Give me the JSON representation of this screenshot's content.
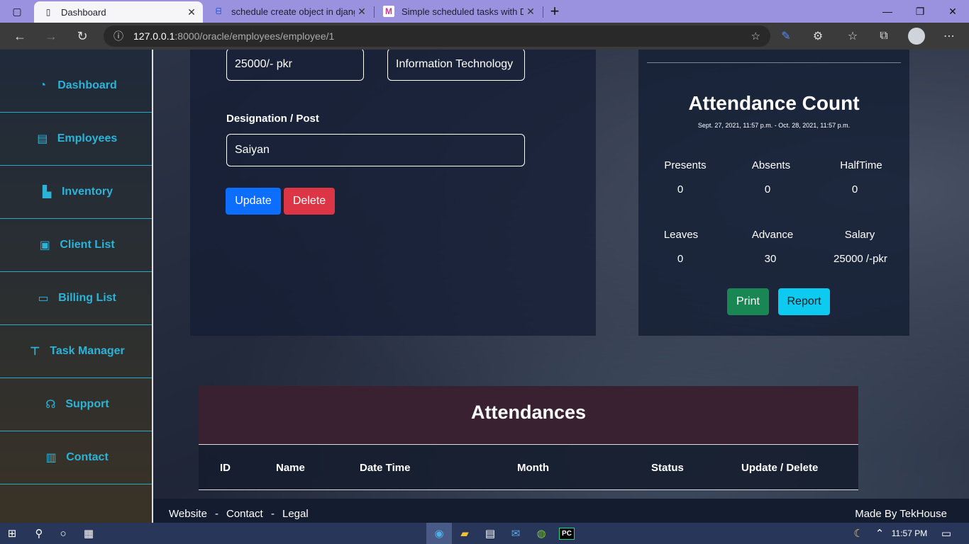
{
  "browser": {
    "tabs": [
      {
        "title": "Dashboard"
      },
      {
        "title": "schedule create object in django"
      },
      {
        "title": "Simple scheduled tasks with Djan"
      }
    ],
    "new_tab_glyph": "+",
    "url_host": "127.0.0.1",
    "url_path": ":8000/oracle/employees/employee/1"
  },
  "sidebar": {
    "items": [
      {
        "label": "Dashboard",
        "icon": "tachometer-icon"
      },
      {
        "label": "Employees",
        "icon": "id-card-icon"
      },
      {
        "label": "Inventory",
        "icon": "dolly-icon"
      },
      {
        "label": "Client List",
        "icon": "contact-book-icon"
      },
      {
        "label": "Billing List",
        "icon": "money-bill-icon"
      },
      {
        "label": "Task Manager",
        "icon": "thumbtack-icon"
      },
      {
        "label": "Support",
        "icon": "headset-icon"
      },
      {
        "label": "Contact",
        "icon": "id-badge-icon"
      }
    ]
  },
  "form": {
    "salary_value": "25000/- pkr",
    "department_value": "Information Technology",
    "designation_label": "Designation / Post",
    "designation_value": "Saiyan",
    "update_label": "Update",
    "delete_label": "Delete"
  },
  "attendance_count": {
    "title": "Attendance Count",
    "range": "Sept. 27, 2021, 11:57 p.m. - Oct. 28, 2021, 11:57 p.m.",
    "stats": [
      {
        "label": "Presents",
        "value": "0"
      },
      {
        "label": "Absents",
        "value": "0"
      },
      {
        "label": "HalfTime",
        "value": "0"
      },
      {
        "label": "Leaves",
        "value": "0"
      },
      {
        "label": "Advance",
        "value": "30"
      },
      {
        "label": "Salary",
        "value": "25000 /-pkr"
      }
    ],
    "print_label": "Print",
    "report_label": "Report"
  },
  "attendances": {
    "title": "Attendances",
    "columns": [
      "ID",
      "Name",
      "Date Time",
      "Month",
      "Status",
      "Update / Delete"
    ]
  },
  "footer": {
    "links": [
      "Website",
      "Contact",
      "Legal"
    ],
    "separator": "-",
    "credit": "Made By TekHouse"
  },
  "taskbar": {
    "time": "11:57 PM"
  },
  "colors": {
    "accent": "#2bb4d8",
    "update": "#0d6efd",
    "delete": "#dc3545",
    "print": "#198754",
    "report": "#0dcaf0"
  }
}
